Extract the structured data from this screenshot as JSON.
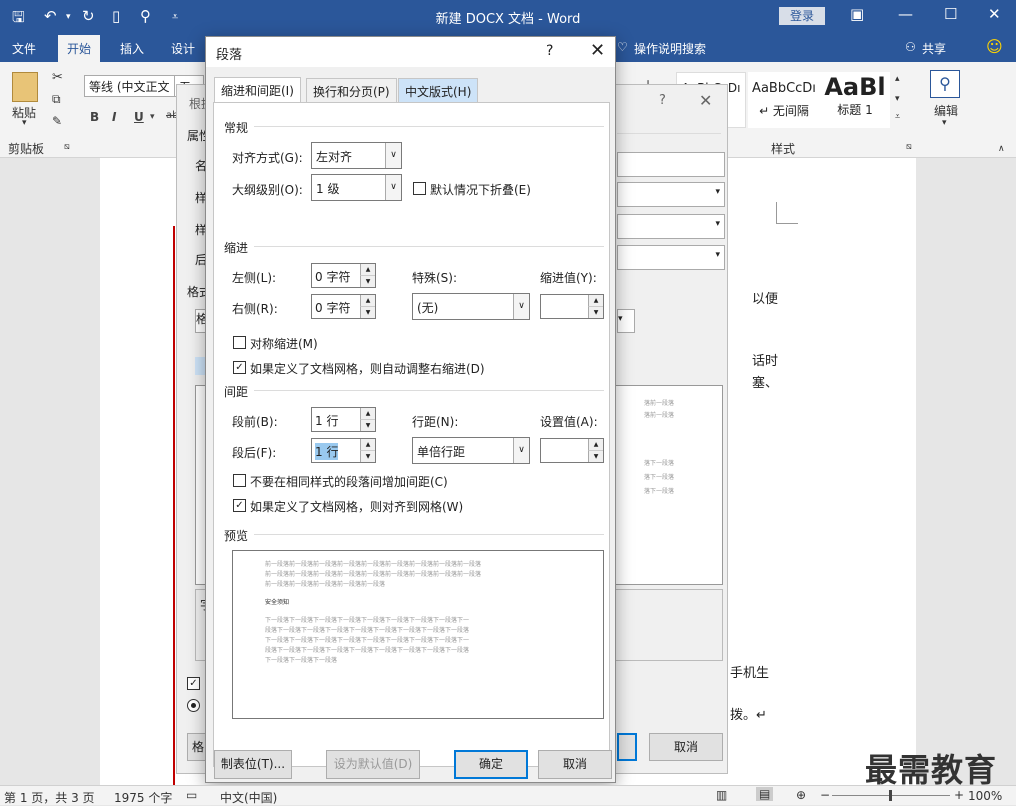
{
  "app": {
    "title": "新建 DOCX 文档  -  Word",
    "login": "登录"
  },
  "menu_tabs": [
    "文件",
    "开始",
    "插入",
    "设计",
    "操作说明搜索",
    "共享"
  ],
  "ribbon": {
    "paste": "粘贴",
    "clipboard": "剪贴板",
    "font_name": "等线 (中文正文",
    "font_size": "五号",
    "style_items": [
      "AaBbCcDı",
      "AaBbCcDı",
      "AaBl"
    ],
    "style_labels": [
      "",
      "↵ 无间隔",
      "标题 1"
    ],
    "styles_group": "样式",
    "edit": "编辑"
  },
  "bg_dialog": {
    "labels": [
      "根据",
      "属性",
      "名",
      "样",
      "样",
      "后",
      "格式",
      "格",
      "字",
      "格"
    ],
    "cancel": "取消"
  },
  "doc_text": [
    "以便",
    "话时",
    "塞、",
    "手机生",
    "拨。↵"
  ],
  "dialog": {
    "title": "段落",
    "help": "?",
    "tabs": [
      "缩进和间距(I)",
      "换行和分页(P)",
      "中文版式(H)"
    ],
    "general": {
      "title": "常规",
      "alignment_label": "对齐方式(G):",
      "alignment": "左对齐",
      "outline_label": "大纲级别(O):",
      "outline": "1 级",
      "collapse_label": "默认情况下折叠(E)"
    },
    "indent": {
      "title": "缩进",
      "left_label": "左侧(L):",
      "left": "0 字符",
      "right_label": "右侧(R):",
      "right": "0 字符",
      "special_label": "特殊(S):",
      "special": "(无)",
      "by_label": "缩进值(Y):",
      "mirror_label": "对称缩进(M)",
      "autoadjust_label": "如果定义了文档网格，则自动调整右缩进(D)"
    },
    "spacing": {
      "title": "间距",
      "before_label": "段前(B):",
      "before": "1 行",
      "after_label": "段后(F):",
      "after": "1 行",
      "line_label": "行距(N):",
      "line": "单倍行距",
      "at_label": "设置值(A):",
      "nospace_label": "不要在相同样式的段落间增加间距(C)",
      "snap_label": "如果定义了文档网格，则对齐到网格(W)"
    },
    "preview": {
      "title": "预览",
      "prev_lines": [
        "前一段落前一段落前一段落前一段落前一段落前一段落前一段落前一段落前一段落",
        "前一段落前一段落前一段落前一段落前一段落前一段落前一段落前一段落前一段落",
        "前一段落前一段落前一段落前一段落前一段落"
      ],
      "current": "安全须知",
      "next_lines": [
        "下一段落下一段落下一段落下一段落下一段落下一段落下一段落下一段落下一",
        "段落下一段落下一段落下一段落下一段落下一段落下一段落下一段落下一段落",
        "下一段落下一段落下一段落下一段落下一段落下一段落下一段落下一段落下一",
        "段落下一段落下一段落下一段落下一段落下一段落下一段落下一段落下一段落",
        "下一段落下一段落下一段落"
      ]
    },
    "buttons": {
      "tabs": "制表位(T)...",
      "default": "设为默认值(D)",
      "ok": "确定",
      "cancel": "取消"
    }
  },
  "bg_preview": [
    "落前一段落",
    "落前一段落",
    "落下一段落",
    "落下一段落",
    "落下一段落"
  ],
  "status": {
    "page": "第 1 页，共 3 页",
    "words": "1975 个字",
    "lang": "中文(中国)",
    "zoom": "100%"
  },
  "watermark": "最需教育"
}
